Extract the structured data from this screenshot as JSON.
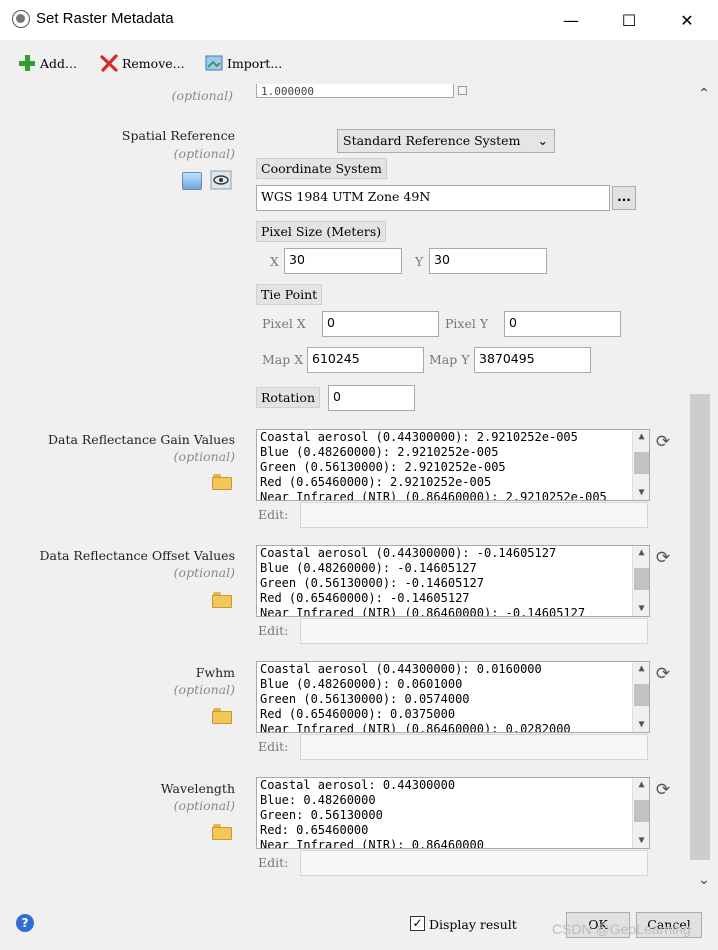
{
  "window": {
    "title": "Set Raster Metadata",
    "minimize_glyph": "—",
    "maximize_glyph": "☐",
    "close_glyph": "✕"
  },
  "toolbar": {
    "add_label": "Add...",
    "remove_label": "Remove...",
    "import_label": "Import..."
  },
  "top_partial": {
    "label": "(optional)",
    "value": "1.000000"
  },
  "spatial_reference": {
    "label": "Spatial Reference",
    "optional": "(optional)",
    "select_value": "Standard Reference System",
    "coord_header": "Coordinate System",
    "coord_value": "WGS 1984 UTM Zone 49N",
    "browse_label": "...",
    "pixel_size_header": "Pixel Size (Meters)",
    "x_label": "X",
    "x_value": "30",
    "y_label": "Y",
    "y_value": "30",
    "tie_point_header": "Tie Point",
    "pixel_x_label": "Pixel X",
    "pixel_x_value": "0",
    "pixel_y_label": "Pixel Y",
    "pixel_y_value": "0",
    "map_x_label": "Map X",
    "map_x_value": "610245",
    "map_y_label": "Map Y",
    "map_y_value": "3870495",
    "rotation_label": "Rotation",
    "rotation_value": "0"
  },
  "sections": [
    {
      "label": "Data Reflectance Gain Values",
      "optional": "(optional)",
      "lines": [
        "Coastal aerosol (0.44300000): 2.9210252e-005",
        "Blue (0.48260000): 2.9210252e-005",
        "Green (0.56130000): 2.9210252e-005",
        "Red (0.65460000): 2.9210252e-005",
        "Near Infrared (NIR) (0.86460000): 2.9210252e-005"
      ],
      "edit_label": "Edit:"
    },
    {
      "label": "Data Reflectance Offset Values",
      "optional": "(optional)",
      "lines": [
        "Coastal aerosol (0.44300000): -0.14605127",
        "Blue (0.48260000): -0.14605127",
        "Green (0.56130000): -0.14605127",
        "Red (0.65460000): -0.14605127",
        "Near Infrared (NIR) (0.86460000): -0.14605127"
      ],
      "edit_label": "Edit:"
    },
    {
      "label": "Fwhm",
      "optional": "(optional)",
      "lines": [
        "Coastal aerosol (0.44300000): 0.0160000",
        "Blue (0.48260000): 0.0601000",
        "Green (0.56130000): 0.0574000",
        "Red (0.65460000): 0.0375000",
        "Near Infrared (NIR) (0.86460000): 0.0282000"
      ],
      "edit_label": "Edit:"
    },
    {
      "label": "Wavelength",
      "optional": "(optional)",
      "lines": [
        "Coastal aerosol: 0.44300000",
        "Blue: 0.48260000",
        "Green: 0.56130000",
        "Red: 0.65460000",
        "Near Infrared (NIR): 0.86460000"
      ],
      "edit_label": "Edit:"
    }
  ],
  "footer": {
    "help_glyph": "?",
    "display_result_label": "Display result",
    "display_result_checked": true,
    "ok_label": "OK",
    "cancel_label": "Cancel",
    "watermark": "CSDN @GeoLearning"
  },
  "icons": {
    "add": "plus-icon",
    "remove": "x-icon",
    "import": "import-icon",
    "refresh": "refresh-icon",
    "folder": "folder-icon",
    "help": "help-icon"
  },
  "colors": {
    "add_green": "#2f9e2f",
    "remove_red": "#d42a2a",
    "help_blue": "#2f6fd6",
    "folder_yellow": "#f3c65a"
  }
}
